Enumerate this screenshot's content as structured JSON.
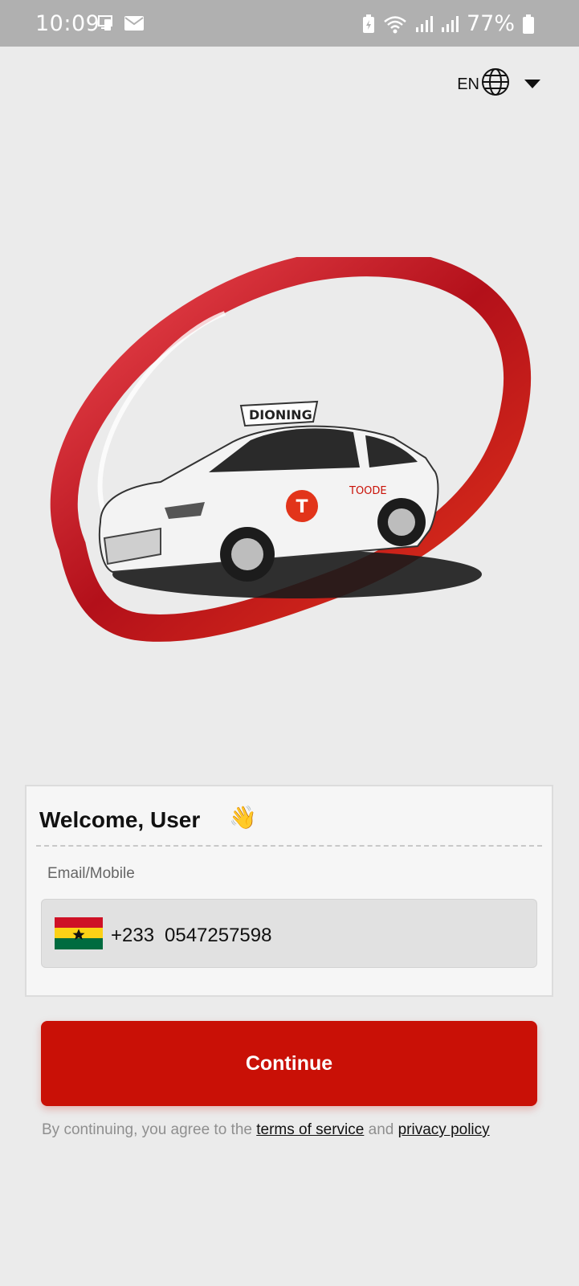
{
  "status_bar": {
    "time": "10:09",
    "battery": "77%",
    "icons": [
      "screen-cast-icon",
      "mail-icon",
      "battery-saver-icon",
      "wifi-icon",
      "signal-icon",
      "signal-icon",
      "battery-icon"
    ]
  },
  "language": {
    "code": "EN",
    "icon": "globe-icon"
  },
  "hero": {
    "sign_text": "DIONING",
    "door_text": "TOODE",
    "logo_letter": "T",
    "colors": {
      "ring": "#d4202a",
      "car": "#f2f2f2"
    }
  },
  "card": {
    "welcome": "Welcome, User",
    "wave_emoji": "👋",
    "field_label": "Email/Mobile",
    "dial_code": "+233",
    "phone_number": "0547257598",
    "flag": "ghana-flag"
  },
  "continue_label": "Continue",
  "legal": {
    "prefix": "By continuing, you agree to the",
    "terms": "terms of service",
    "and": "and",
    "privacy": "privacy policy"
  },
  "colors": {
    "accent": "#c91006",
    "background": "#ebebeb",
    "status_bar": "#b0b0b0"
  }
}
